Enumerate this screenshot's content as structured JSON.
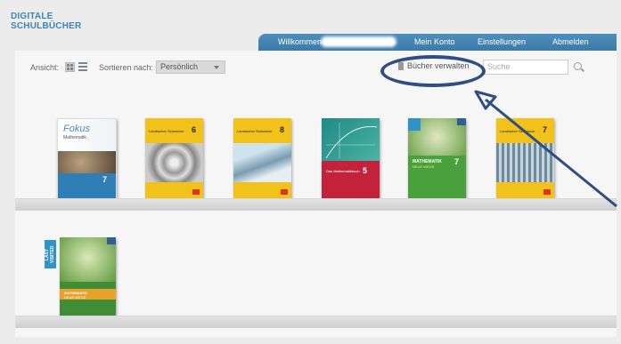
{
  "brand": {
    "line1": "DIGITALE",
    "line2": "SCHULBÜCHER"
  },
  "nav": {
    "welcome": "Willkommen",
    "account": "Mein Konto",
    "settings": "Einstellungen",
    "logout": "Abmelden"
  },
  "toolbar": {
    "view_label": "Ansicht:",
    "sort_label": "Sortieren nach:",
    "sort_value": "Persönlich",
    "manage_books": "Bücher verwalten",
    "search_value": "Suche"
  },
  "books_row1": [
    {
      "title": "Fokus",
      "subtitle": "Mathematik",
      "number": "7"
    },
    {
      "title": "Lambacher Schweizer",
      "number": "6"
    },
    {
      "title": "Lambacher Schweizer",
      "number": "8"
    },
    {
      "title": "Das Mathematikbuch",
      "number": "5"
    },
    {
      "title": "MATHEMATIK",
      "subtitle": "NEUE WEGE",
      "number": "7"
    },
    {
      "title": "Lambacher Schweizer",
      "number": "7"
    }
  ],
  "books_row2": [
    {
      "title": "MATHEMATIK",
      "subtitle": "NEUE WEGE",
      "badge": "LAST VISITED"
    }
  ],
  "colors": {
    "brand_blue": "#3d86b3",
    "nav_blue": "#4287b6",
    "annotation": "#2f4e82",
    "lambacher_yellow": "#f1c40f"
  }
}
